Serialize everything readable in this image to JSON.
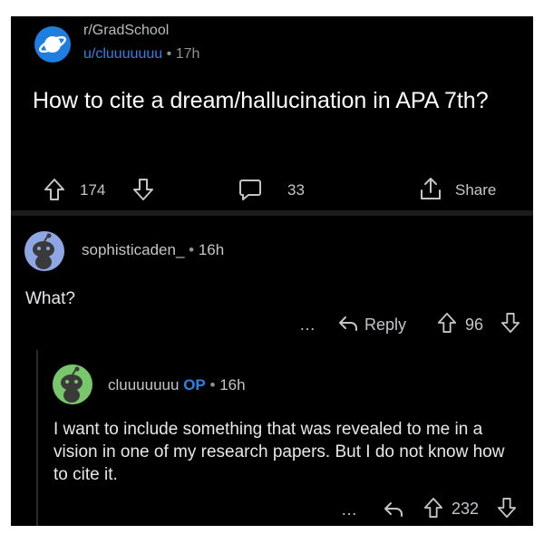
{
  "post": {
    "subreddit": "r/GradSchool",
    "author": "u/cluuuuuuu",
    "separator": "•",
    "age": "17h",
    "title": "How to cite a dream/hallucination in APA 7th?",
    "upvotes": "174",
    "comments": "33",
    "share_label": "Share"
  },
  "comment1": {
    "author": "sophisticaden_",
    "separator": "•",
    "age": "16h",
    "body": "What?",
    "more": "…",
    "reply_label": "Reply",
    "votes": "96"
  },
  "comment2": {
    "author": "cluuuuuuu",
    "op_badge": "OP",
    "separator": "•",
    "age": "16h",
    "body": "I want to include something that was revealed to me in a vision in one of my research papers. But I do not know how to cite it.",
    "more": "…",
    "votes": "232"
  },
  "colors": {
    "background": "#000000",
    "link_blue": "#2e82e6",
    "avatar1": "#8ea6e3",
    "avatar2": "#78c86b"
  },
  "icons": [
    "subreddit-planet-icon",
    "upvote-icon",
    "downvote-icon",
    "comment-icon",
    "share-icon",
    "more-icon",
    "reply-icon",
    "snoo-avatar-icon"
  ]
}
